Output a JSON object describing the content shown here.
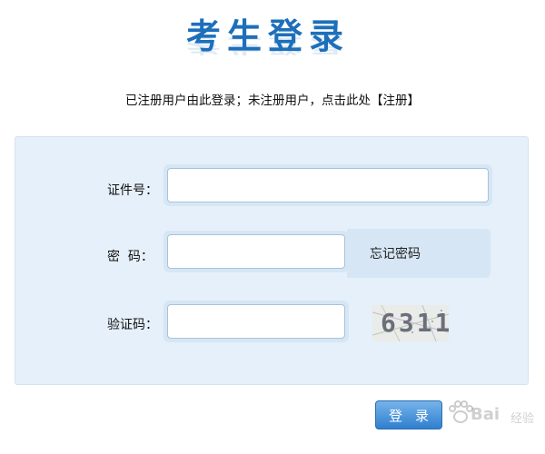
{
  "header": {
    "title": "考生登录",
    "subtitle": "已注册用户由此登录；未注册用户，点击此处【注册】"
  },
  "form": {
    "id_label": "证件号：",
    "id_value": "",
    "password_label": "密  码：",
    "password_value": "",
    "forgot_link": "忘记密码",
    "captcha_label": "验证码：",
    "captcha_value": "",
    "captcha_image_text": "6311",
    "login_label": "登录"
  },
  "watermark": {
    "brand": "Bai",
    "brand_sub": "经验"
  },
  "colors": {
    "title": "#1d6fba",
    "panel": "#e6f0fa",
    "button": "#2f7fcf"
  }
}
